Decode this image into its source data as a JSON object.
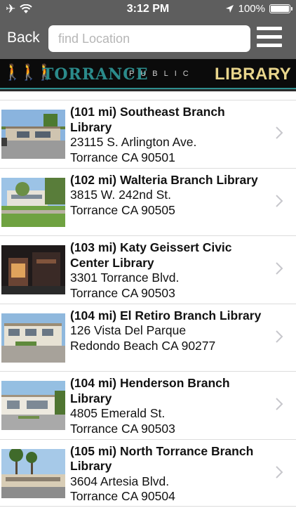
{
  "status_bar": {
    "time": "3:12 PM",
    "battery": "100%",
    "icons": [
      "airplane-icon",
      "wifi-icon",
      "location-arrow-icon",
      "battery-icon"
    ]
  },
  "nav": {
    "back_label": "Back",
    "search_placeholder": "find Location",
    "search_value": "",
    "menu_icon": "hamburger-menu-icon"
  },
  "banner": {
    "part1": "TORRANCE",
    "part2": "PUBLIC",
    "part3": "LIBRARY"
  },
  "locations": [
    {
      "name": "(101 mi) Southeast Branch Library",
      "street": "23115 S. Arlington Ave.",
      "city": "Torrance CA 90501"
    },
    {
      "name": "(102 mi) Walteria Branch Library",
      "street": "3815 W. 242nd St.",
      "city": "Torrance CA 90505"
    },
    {
      "name": "(103 mi) Katy Geissert Civic Center Library",
      "street": "3301 Torrance Blvd.",
      "city": "Torrance CA 90503"
    },
    {
      "name": "(104 mi) El Retiro Branch Library",
      "street": "126 Vista Del Parque",
      "city": "Redondo Beach CA 90277"
    },
    {
      "name": "(104 mi) Henderson Branch Library",
      "street": "4805 Emerald St.",
      "city": "Torrance CA 90503"
    },
    {
      "name": "(105 mi) North Torrance Branch Library",
      "street": "3604 Artesia Blvd.",
      "city": "Torrance CA 90504"
    }
  ]
}
